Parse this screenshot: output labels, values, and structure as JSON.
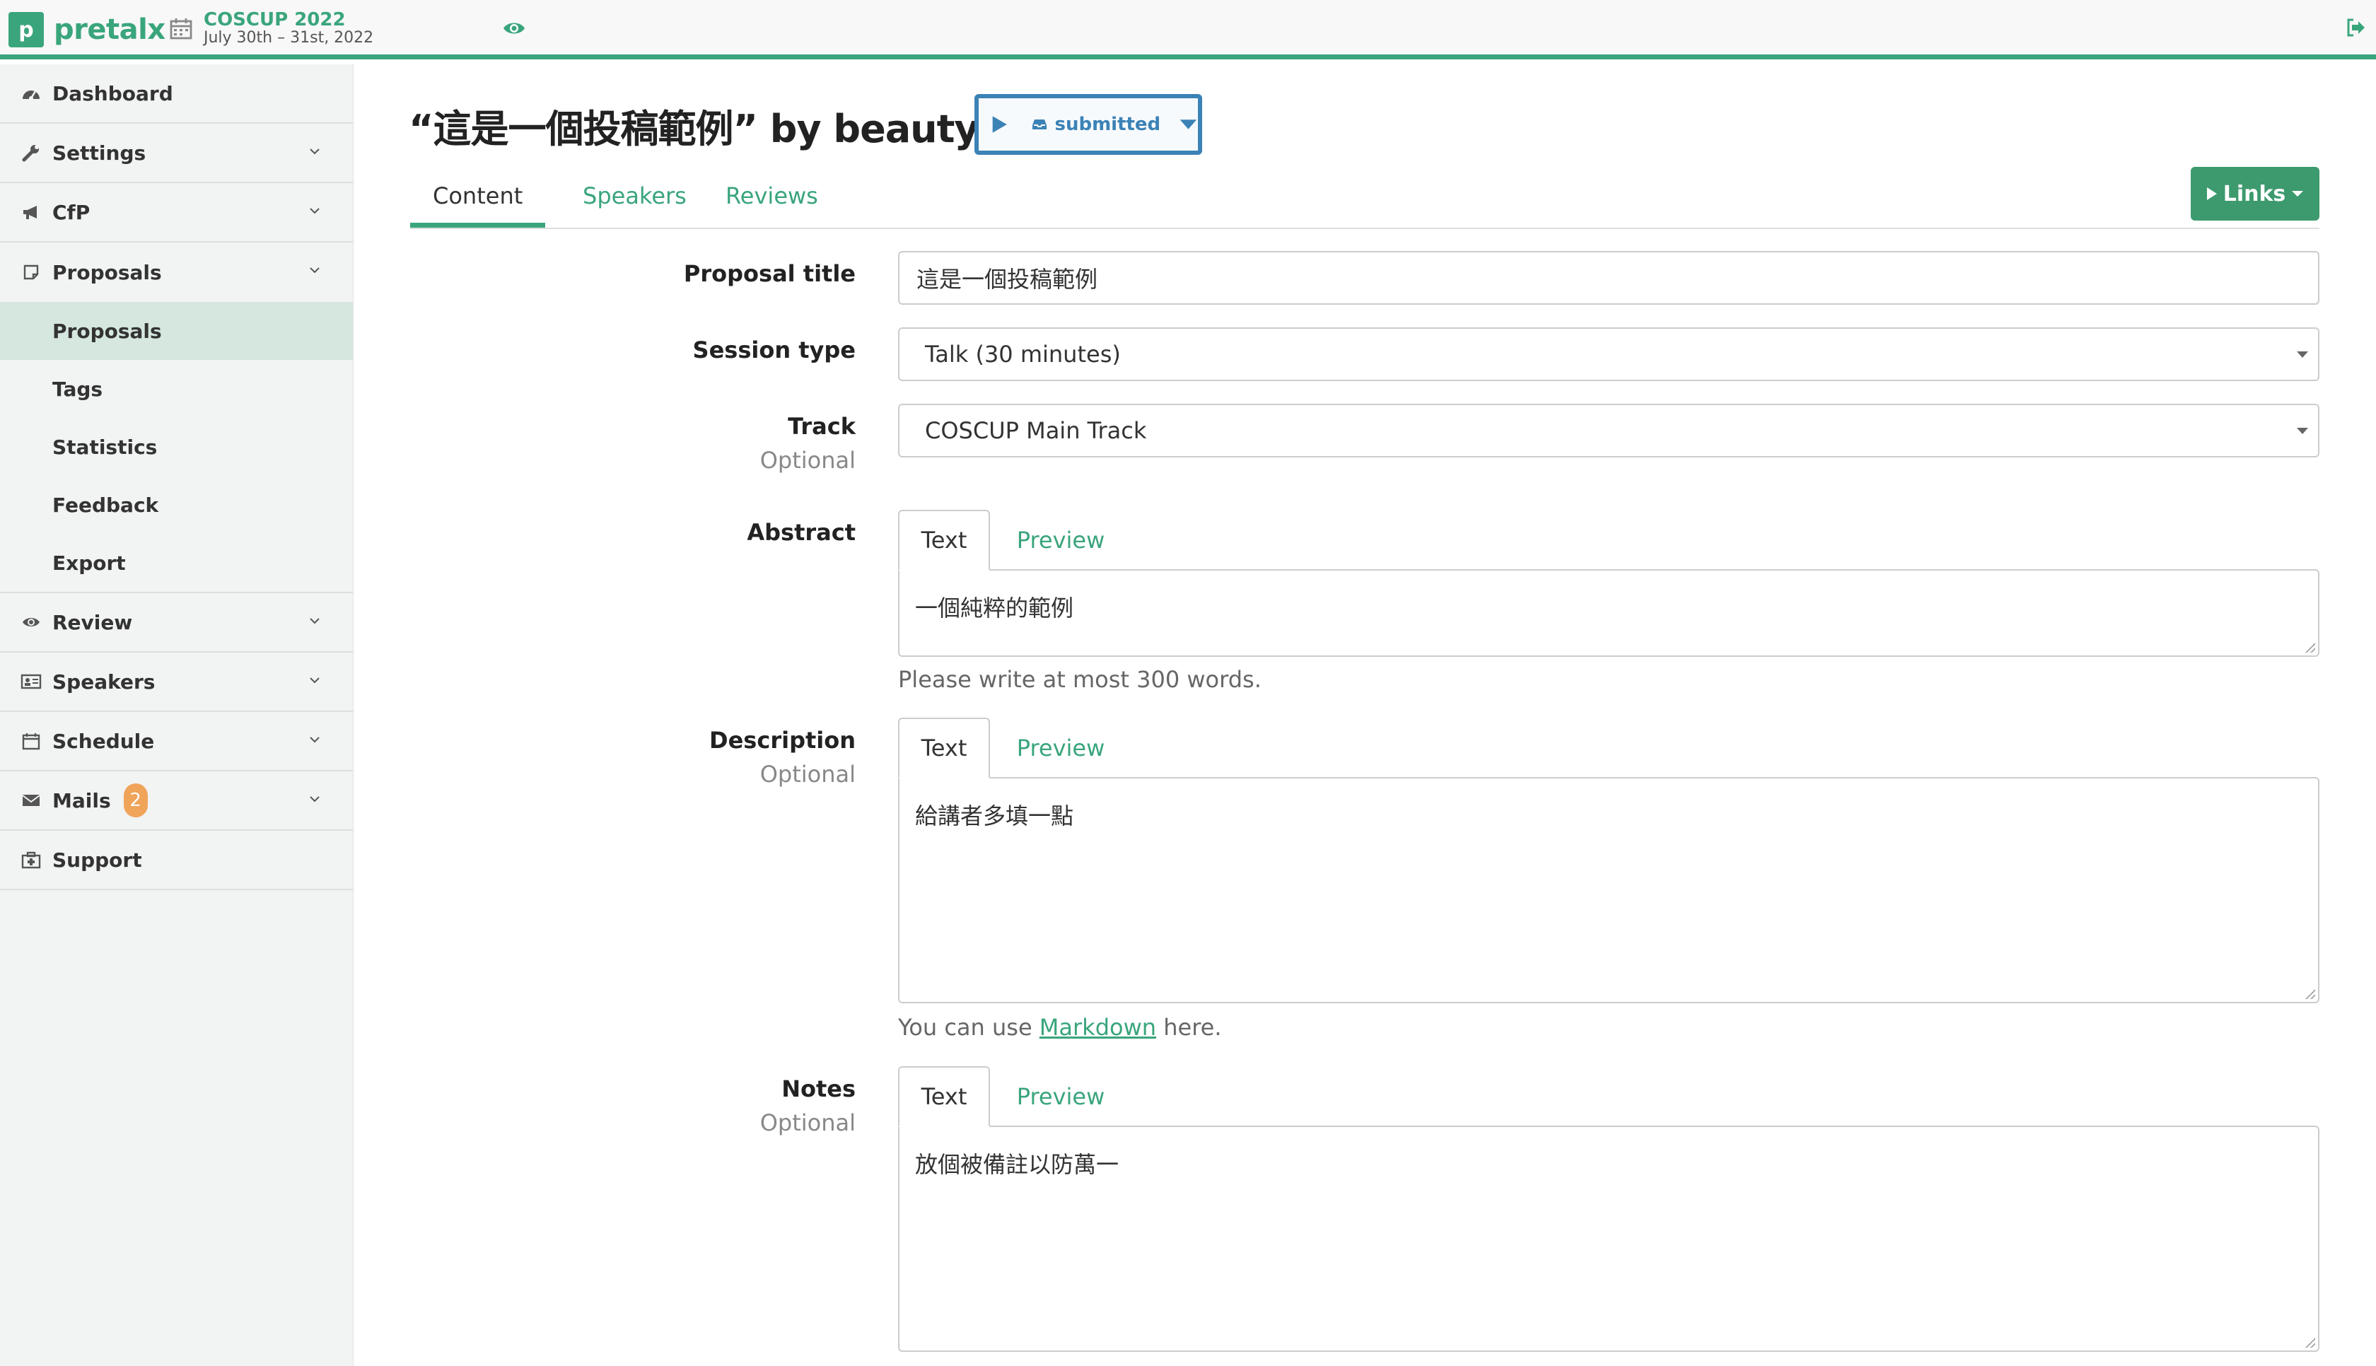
{
  "app": {
    "logo_letter": "p",
    "name": "pretalx"
  },
  "event": {
    "title": "COSCUP 2022",
    "dates": "July 30th – 31st, 2022"
  },
  "sidebar": {
    "items": [
      {
        "label": "Dashboard",
        "icon": "dashboard-icon"
      },
      {
        "label": "Settings",
        "icon": "wrench-icon"
      },
      {
        "label": "CfP",
        "icon": "bullhorn-icon"
      },
      {
        "label": "Proposals",
        "icon": "sticky-note-icon"
      },
      {
        "label": "Review",
        "icon": "eye-icon"
      },
      {
        "label": "Speakers",
        "icon": "id-card-icon"
      },
      {
        "label": "Schedule",
        "icon": "calendar-icon"
      },
      {
        "label": "Mails",
        "icon": "envelope-icon",
        "badge": "2"
      },
      {
        "label": "Support",
        "icon": "medkit-icon"
      }
    ],
    "proposals_sub": [
      "Proposals",
      "Tags",
      "Statistics",
      "Feedback",
      "Export"
    ]
  },
  "submission": {
    "title": "“這是一個投稿範例” by beautylu",
    "state": "submitted"
  },
  "tabs": [
    "Content",
    "Speakers",
    "Reviews"
  ],
  "links_label": "Links",
  "form": {
    "proposal_title": {
      "label": "Proposal title",
      "value": "這是一個投稿範例"
    },
    "session_type": {
      "label": "Session type",
      "value": "Talk (30 minutes)"
    },
    "track": {
      "label": "Track",
      "optional": "Optional",
      "value": "COSCUP Main Track"
    },
    "abstract": {
      "label": "Abstract",
      "tab_text": "Text",
      "tab_preview": "Preview",
      "value": "一個純粹的範例",
      "help": "Please write at most 300 words."
    },
    "description": {
      "label": "Description",
      "optional": "Optional",
      "tab_text": "Text",
      "tab_preview": "Preview",
      "value": "給講者多填一點",
      "help_before": "You can use ",
      "help_link": "Markdown",
      "help_after": " here."
    },
    "notes": {
      "label": "Notes",
      "optional": "Optional",
      "tab_text": "Text",
      "tab_preview": "Preview",
      "value": "放個被備註以防萬一"
    }
  },
  "colors": {
    "accent": "#3aa57c",
    "state": "#3b82b6",
    "badge": "#f0a45a"
  }
}
